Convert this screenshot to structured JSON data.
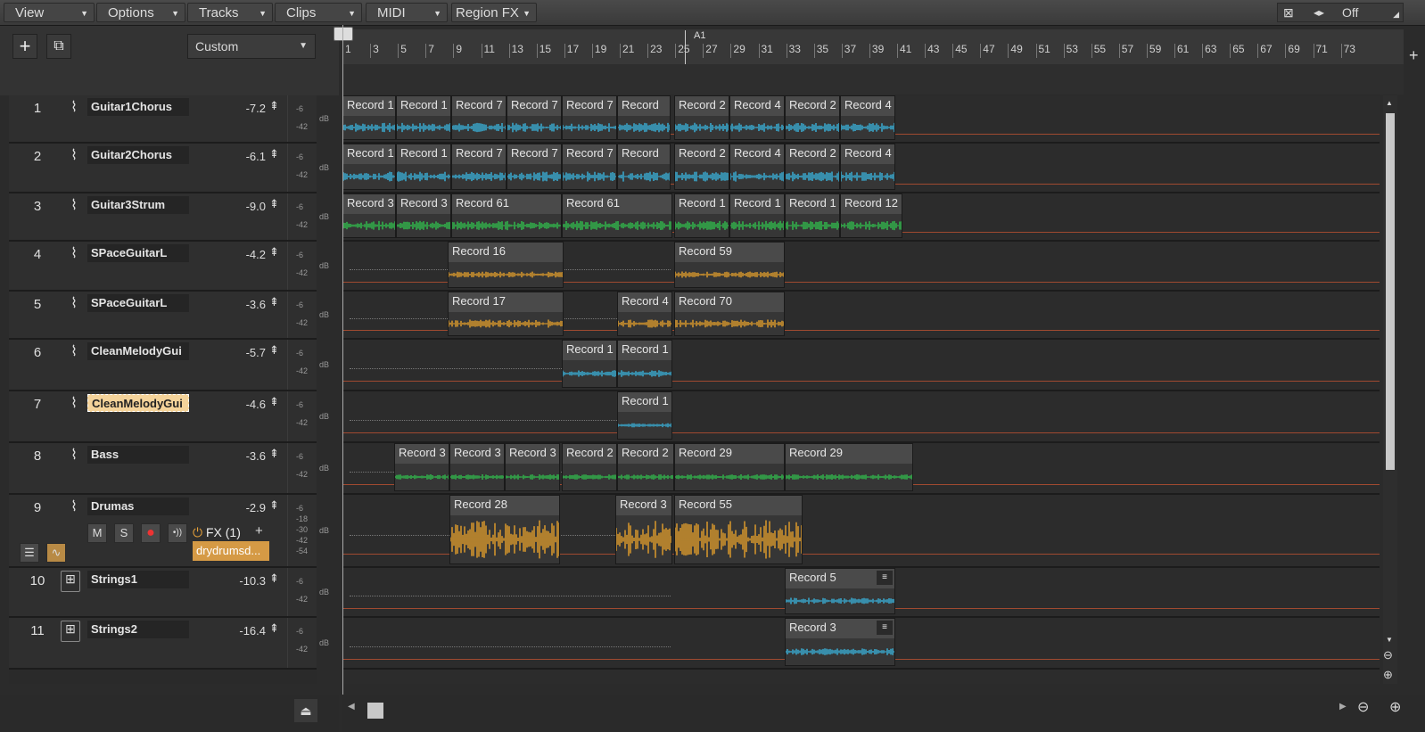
{
  "menus": [
    {
      "label": "View"
    },
    {
      "label": "Options"
    },
    {
      "label": "Tracks"
    },
    {
      "label": "Clips"
    },
    {
      "label": "MIDI"
    },
    {
      "label": "Region FX"
    }
  ],
  "snap": {
    "value": "Off"
  },
  "toolbar": {
    "add_label": "+",
    "preset": "Custom"
  },
  "ruler": {
    "ticks": [
      "1",
      "3",
      "5",
      "7",
      "9",
      "11",
      "13",
      "15",
      "17",
      "19",
      "21",
      "23",
      "25",
      "27",
      "29",
      "31",
      "33",
      "35",
      "37",
      "39",
      "41",
      "43",
      "45",
      "47",
      "49",
      "51",
      "53",
      "55",
      "57",
      "59",
      "61",
      "63",
      "65",
      "67",
      "69",
      "71",
      "73"
    ],
    "marker": "A1"
  },
  "tracks": [
    {
      "num": "1",
      "name": "Guitar1Chorus",
      "vol": "-7.2",
      "meters": [
        "-6",
        "-42"
      ],
      "icon": "waveform-icon"
    },
    {
      "num": "2",
      "name": "Guitar2Chorus",
      "vol": "-6.1",
      "meters": [
        "-6",
        "-42"
      ],
      "icon": "waveform-icon"
    },
    {
      "num": "3",
      "name": "Guitar3Strum",
      "vol": "-9.0",
      "meters": [
        "-6",
        "-42"
      ],
      "icon": "waveform-icon"
    },
    {
      "num": "4",
      "name": "SPaceGuitarL",
      "vol": "-4.2",
      "meters": [
        "-6",
        "-42"
      ],
      "icon": "waveform-icon"
    },
    {
      "num": "5",
      "name": "SPaceGuitarL",
      "vol": "-3.6",
      "meters": [
        "-6",
        "-42"
      ],
      "icon": "waveform-icon"
    },
    {
      "num": "6",
      "name": "CleanMelodyGui",
      "vol": "-5.7",
      "meters": [
        "-6",
        "-42"
      ],
      "icon": "waveform-icon"
    },
    {
      "num": "7",
      "name": "CleanMelodyGui",
      "vol": "-4.6",
      "meters": [
        "-6",
        "-42"
      ],
      "icon": "waveform-icon"
    },
    {
      "num": "8",
      "name": "Bass",
      "vol": "-3.6",
      "meters": [
        "-6",
        "-42"
      ],
      "icon": "waveform-icon"
    },
    {
      "num": "9",
      "name": "Drumas",
      "vol": "-2.9",
      "meters": [
        "-6",
        "-18",
        "-30",
        "-42",
        "-54"
      ],
      "icon": "waveform-icon"
    },
    {
      "num": "10",
      "name": "Strings1",
      "vol": "-10.3",
      "meters": [
        "-6",
        "-42"
      ],
      "icon": "instrument-icon"
    },
    {
      "num": "11",
      "name": "Strings2",
      "vol": "-16.4",
      "meters": [
        "-6",
        "-42"
      ],
      "icon": "instrument-icon"
    }
  ],
  "drums_controls": {
    "mute": "M",
    "solo": "S",
    "fx_label": "FX (1)",
    "fx_add": "+",
    "plugin": "drydrumsd..."
  },
  "db_label": "dB",
  "clips": [
    {
      "track": 0,
      "clips": [
        "Record 1",
        "Record 1",
        "Record 7",
        "Record 7",
        "Record 7",
        "Record",
        "Record 2",
        "Record 4",
        "Record 2",
        "Record 4"
      ]
    },
    {
      "track": 1,
      "clips": [
        "Record 1",
        "Record 1",
        "Record 7",
        "Record 7",
        "Record 7",
        "Record",
        "Record 2",
        "Record 4",
        "Record 2",
        "Record 4"
      ]
    },
    {
      "track": 2,
      "clips": [
        "Record 3",
        "Record 3",
        "Record 61",
        "Record 61",
        "Record 1",
        "Record 1",
        "Record 1",
        "Record 12"
      ]
    },
    {
      "track": 3,
      "clips": [
        "Record 16",
        "Record 59"
      ]
    },
    {
      "track": 4,
      "clips": [
        "Record 17",
        "Record 4",
        "Record 70"
      ]
    },
    {
      "track": 5,
      "clips": [
        "Record 1",
        "Record 1"
      ]
    },
    {
      "track": 6,
      "clips": [
        "Record 1"
      ]
    },
    {
      "track": 7,
      "clips": [
        "Record 3",
        "Record 3",
        "Record 3",
        "Record 2",
        "Record 2",
        "Record 29",
        "Record 29"
      ]
    },
    {
      "track": 8,
      "clips": [
        "Record 28",
        "Record 3",
        "Record 55"
      ]
    },
    {
      "track": 9,
      "clips": [
        "Record 5"
      ]
    },
    {
      "track": 10,
      "clips": [
        "Record 3"
      ]
    }
  ],
  "colors": {
    "blue": "#3ab4de",
    "green": "#31c14e",
    "orange": "#e6a02b"
  }
}
